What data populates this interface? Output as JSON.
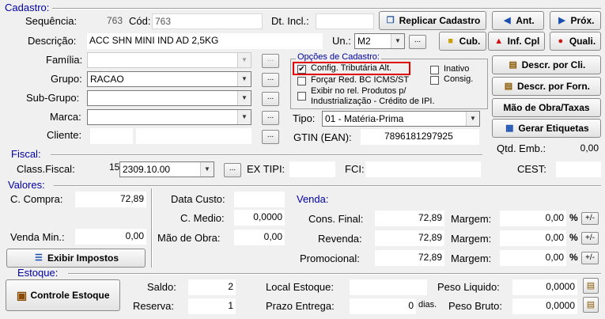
{
  "cadastro": {
    "section_label": "Cadastro:",
    "sequencia_label": "Sequência:",
    "sequencia_value": "763",
    "cod_label": "Cód:",
    "cod_value": "763",
    "dt_incl_label": "Dt. Incl.:",
    "dt_incl_value": "",
    "descricao_label": "Descrição:",
    "descricao_value": "ACC SHN MINI IND AD 2,5KG",
    "un_label": "Un.:",
    "un_value": "M2",
    "familia_label": "Família:",
    "familia_value": "",
    "grupo_label": "Grupo:",
    "grupo_value": "RACAO",
    "subgrupo_label": "Sub-Grupo:",
    "subgrupo_value": "",
    "marca_label": "Marca:",
    "marca_value": "",
    "cliente_label": "Cliente:",
    "cliente_code": "",
    "cliente_name": "",
    "tipo_label": "Tipo:",
    "tipo_value": "01 - Matéria-Prima",
    "gtin_label": "GTIN (EAN):",
    "gtin_value": "7896181297925",
    "ellipsis": "..."
  },
  "opcoes": {
    "title": "Opções de Cadastro:",
    "config_trib": "Config. Tributária Alt.",
    "forcar_red": "Forçar Red. BC ICMS/ST",
    "exibir_rel_line1": "Exibir no rel. Produtos p/",
    "exibir_rel_line2": "Industrialização - Crédito de IPI.",
    "inativo": "Inativo",
    "consig": "Consig.",
    "check_mark": "✔"
  },
  "buttons": {
    "replicar": "Replicar Cadastro",
    "ant": "Ant.",
    "prox": "Próx.",
    "cub": "Cub.",
    "inf_cpl": "Inf. Cpl",
    "quali": "Quali.",
    "descr_cli": "Descr. por Cli.",
    "descr_forn": "Descr. por Forn.",
    "mao_obra_taxas": "Mão de Obra/Taxas",
    "gerar_etiquetas": "Gerar Etiquetas",
    "exibir_impostos": "Exibir Impostos",
    "controle_estoque": "Controle Estoque"
  },
  "qtd_emb": {
    "label": "Qtd. Emb.:",
    "value": "0,00"
  },
  "cest": {
    "label": "CEST:",
    "value": ""
  },
  "fiscal": {
    "section_label": "Fiscal:",
    "class_label": "Class.Fiscal:",
    "class_prefix": "15",
    "class_value": "2309.10.00",
    "ex_tipi_label": "EX TIPI:",
    "ex_tipi_value": "",
    "fci_label": "FCI:",
    "fci_value": ""
  },
  "valores": {
    "section_label": "Valores:",
    "c_compra_label": "C. Compra:",
    "c_compra_value": "72,89",
    "venda_min_label": "Venda Min.:",
    "venda_min_value": "0,00",
    "data_custo_label": "Data Custo:",
    "data_custo_value": "",
    "c_medio_label": "C. Medio:",
    "c_medio_value": "0,0000",
    "mao_obra_label": "Mão de Obra:",
    "mao_obra_value": "0,00",
    "venda_label": "Venda:",
    "cons_final_label": "Cons. Final:",
    "cons_final_value": "72,89",
    "revenda_label": "Revenda:",
    "revenda_value": "72,89",
    "promocional_label": "Promocional:",
    "promocional_value": "72,89",
    "margem_label": "Margem:",
    "margem1_value": "0,00",
    "margem2_value": "0,00",
    "margem3_value": "0,00",
    "percent": "%",
    "plus_minus": "+/-"
  },
  "estoque": {
    "section_label": "Estoque:",
    "saldo_label": "Saldo:",
    "saldo_value": "2",
    "reserva_label": "Reserva:",
    "reserva_value": "1",
    "local_label": "Local Estoque:",
    "local_value": "",
    "prazo_label": "Prazo Entrega:",
    "prazo_value": "0",
    "dias_label": "dias.",
    "peso_liq_label": "Peso Liquido:",
    "peso_liq_value": "0,0000",
    "peso_bruto_label": "Peso Bruto:",
    "peso_bruto_value": "0,0000"
  },
  "colors": {
    "section_blue": "#0000a0",
    "highlight_red": "#e00000"
  }
}
